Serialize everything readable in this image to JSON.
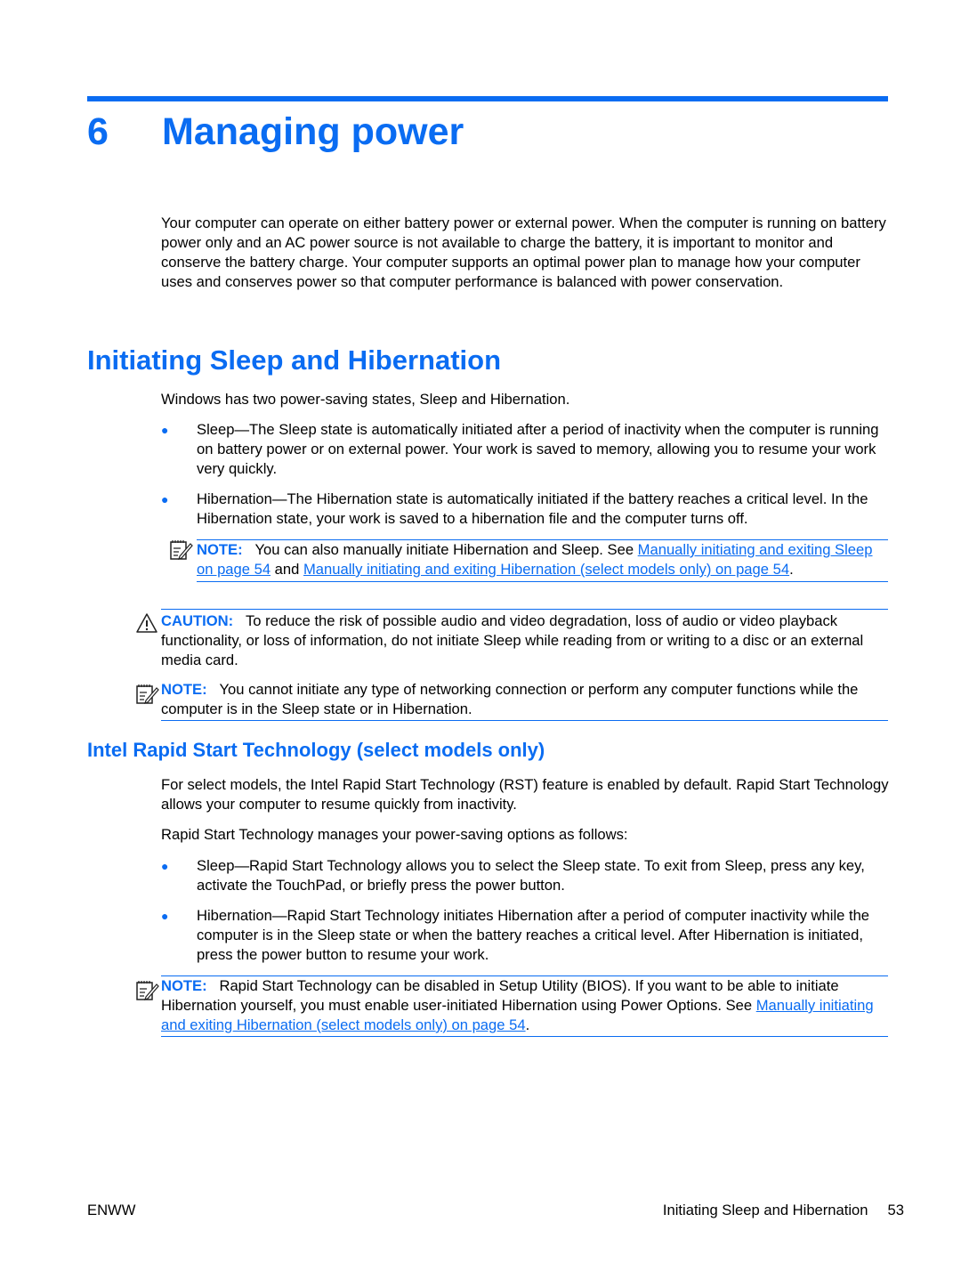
{
  "chapter": {
    "number": "6",
    "title": "Managing power",
    "intro": "Your computer can operate on either battery power or external power. When the computer is running on battery power only and an AC power source is not available to charge the battery, it is important to monitor and conserve the battery charge. Your computer supports an optimal power plan to manage how your computer uses and conserves power so that computer performance is balanced with power conservation."
  },
  "section1": {
    "title": "Initiating Sleep and Hibernation",
    "intro": "Windows has two power-saving states, Sleep and Hibernation.",
    "bullets": [
      {
        "text": "Sleep—The Sleep state is automatically initiated after a period of inactivity when the computer is running on battery power or on external power. Your work is saved to memory, allowing you to resume your work very quickly."
      },
      {
        "text": "Hibernation—The Hibernation state is automatically initiated if the battery reaches a critical level. In the Hibernation state, your work is saved to a hibernation file and the computer turns off."
      }
    ],
    "note1": {
      "label": "NOTE:",
      "text_before": "You can also manually initiate Hibernation and Sleep. See ",
      "link1": "Manually initiating and exiting Sleep on page 54",
      "text_between": " and ",
      "link2": "Manually initiating and exiting Hibernation (select models only) on page 54",
      "text_after": "."
    },
    "caution": {
      "label": "CAUTION:",
      "text": "To reduce the risk of possible audio and video degradation, loss of audio or video playback functionality, or loss of information, do not initiate Sleep while reading from or writing to a disc or an external media card."
    },
    "note2": {
      "label": "NOTE:",
      "text": "You cannot initiate any type of networking connection or perform any computer functions while the computer is in the Sleep state or in Hibernation."
    }
  },
  "section2": {
    "title": "Intel Rapid Start Technology (select models only)",
    "para1": "For select models, the Intel Rapid Start Technology (RST) feature is enabled by default. Rapid Start Technology allows your computer to resume quickly from inactivity.",
    "para2": "Rapid Start Technology manages your power-saving options as follows:",
    "bullets": [
      {
        "text": "Sleep—Rapid Start Technology allows you to select the Sleep state. To exit from Sleep, press any key, activate the TouchPad, or briefly press the power button."
      },
      {
        "text": "Hibernation—Rapid Start Technology initiates Hibernation after a period of computer inactivity while the computer is in the Sleep state or when the battery reaches a critical level. After Hibernation is initiated, press the power button to resume your work."
      }
    ],
    "note": {
      "label": "NOTE:",
      "text": "Rapid Start Technology can be disabled in Setup Utility (BIOS). If you want to be able to initiate Hibernation yourself, you must enable user-initiated Hibernation using Power Options. See ",
      "link": "Manually initiating and exiting Hibernation (select models only) on page 54",
      "text_after": "."
    }
  },
  "footer": {
    "left": "ENWW",
    "section": "Initiating Sleep and Hibernation",
    "page": "53"
  },
  "colors": {
    "accent": "#0a6cf2"
  }
}
